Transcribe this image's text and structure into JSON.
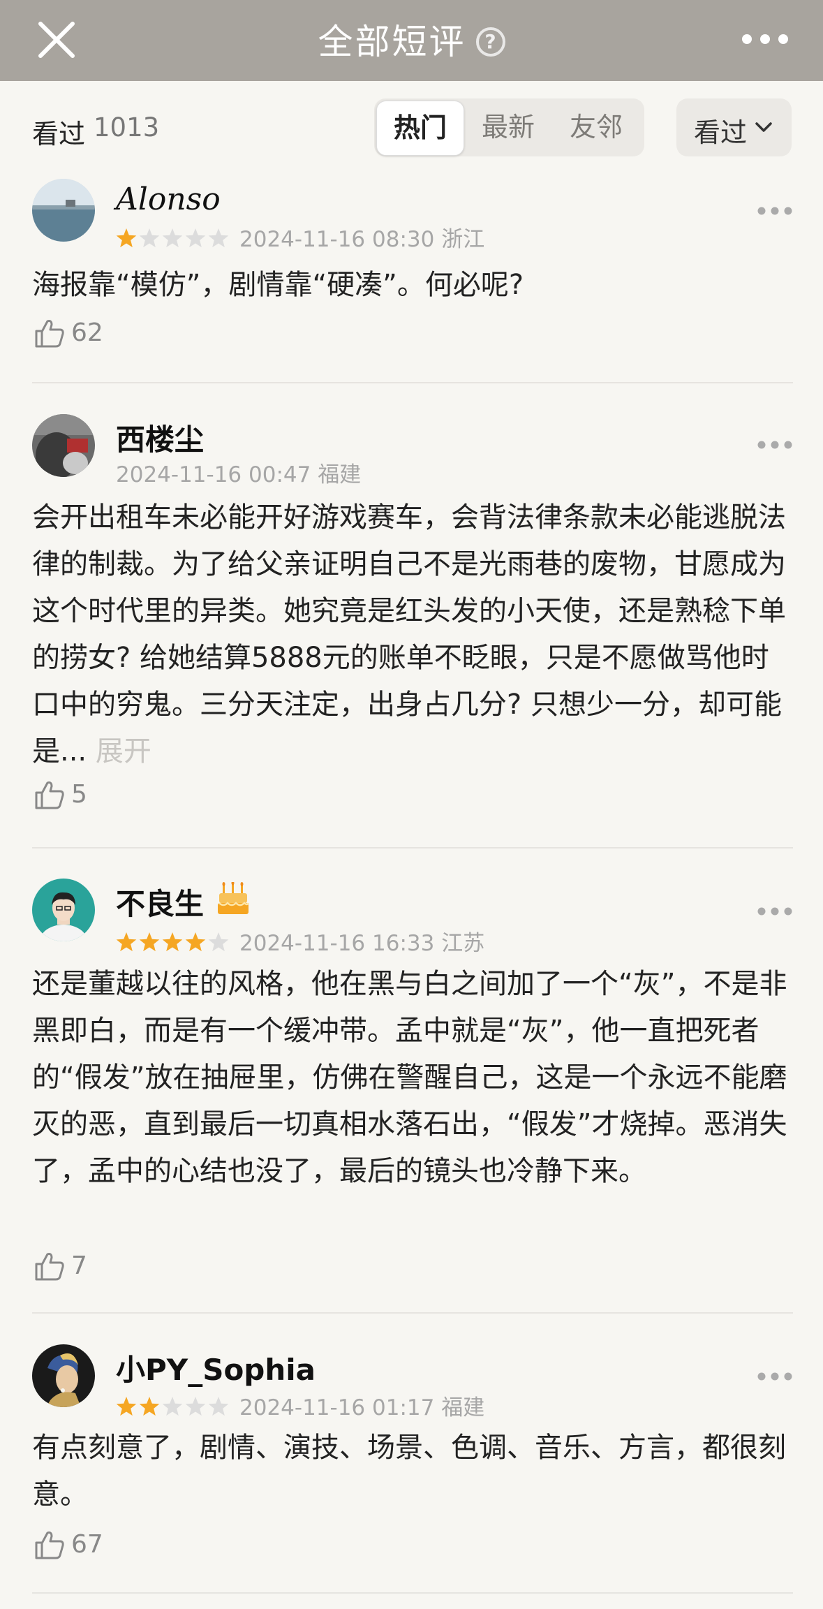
{
  "nav": {
    "title": "全部短评",
    "help_icon": "?",
    "close_icon": "close-icon",
    "more_icon": "more-dots-icon",
    "background": "#a8a49e"
  },
  "filter": {
    "seen_label": "看过",
    "seen_count": "1013",
    "tabs": [
      {
        "label": "热门",
        "active": true
      },
      {
        "label": "最新",
        "active": false
      },
      {
        "label": "友邻",
        "active": false
      }
    ],
    "dropdown_label": "看过"
  },
  "reviews": [
    {
      "user": "Alonso",
      "stars": 1,
      "time": "2024-11-16 08:30",
      "location": "浙江",
      "text": "海报靠“模仿”，剧情靠“硬凑”。何必呢?",
      "likes": "62"
    },
    {
      "user": "西楼尘",
      "stars": 0,
      "time": "2024-11-16 00:47",
      "location": "福建",
      "text": "会开出租车未必能开好游戏赛车，会背法律条款未必能逃脱法律的制裁。为了给父亲证明自己不是光雨巷的废物，甘愿成为这个时代里的异类。她究竟是红头发的小天使，还是熟稔下单的捞女? 给她结算5888元的账单不眨眼，只是不愿做骂他时口中的穷鬼。三分天注定，出身占几分? 只想少一分，却可能是...",
      "expand": "展开",
      "likes": "5"
    },
    {
      "user": "不良生",
      "badge_icon": "birthday-cake-icon",
      "stars": 4,
      "time": "2024-11-16 16:33",
      "location": "江苏",
      "text": "还是董越以往的风格，他在黑与白之间加了一个“灰”，不是非黑即白，而是有一个缓冲带。孟中就是“灰”，他一直把死者的“假发”放在抽屉里，仿佛在警醒自己，这是一个永远不能磨灭的恶，直到最后一切真相水落石出，“假发”才烧掉。恶消失了，孟中的心结也没了，最后的镜头也冷静下来。",
      "likes": "7"
    },
    {
      "user": "小PY_Sophia",
      "stars": 2,
      "time": "2024-11-16 01:17",
      "location": "福建",
      "text": "有点刻意了，剧情、演技、场景、色调、音乐、方言，都很刻意。",
      "likes": "67"
    }
  ],
  "colors": {
    "star_filled": "#f5a623",
    "star_empty": "#dcdcdc",
    "meta_gray": "#a6a6a6",
    "page_bg": "#f7f6f2"
  }
}
